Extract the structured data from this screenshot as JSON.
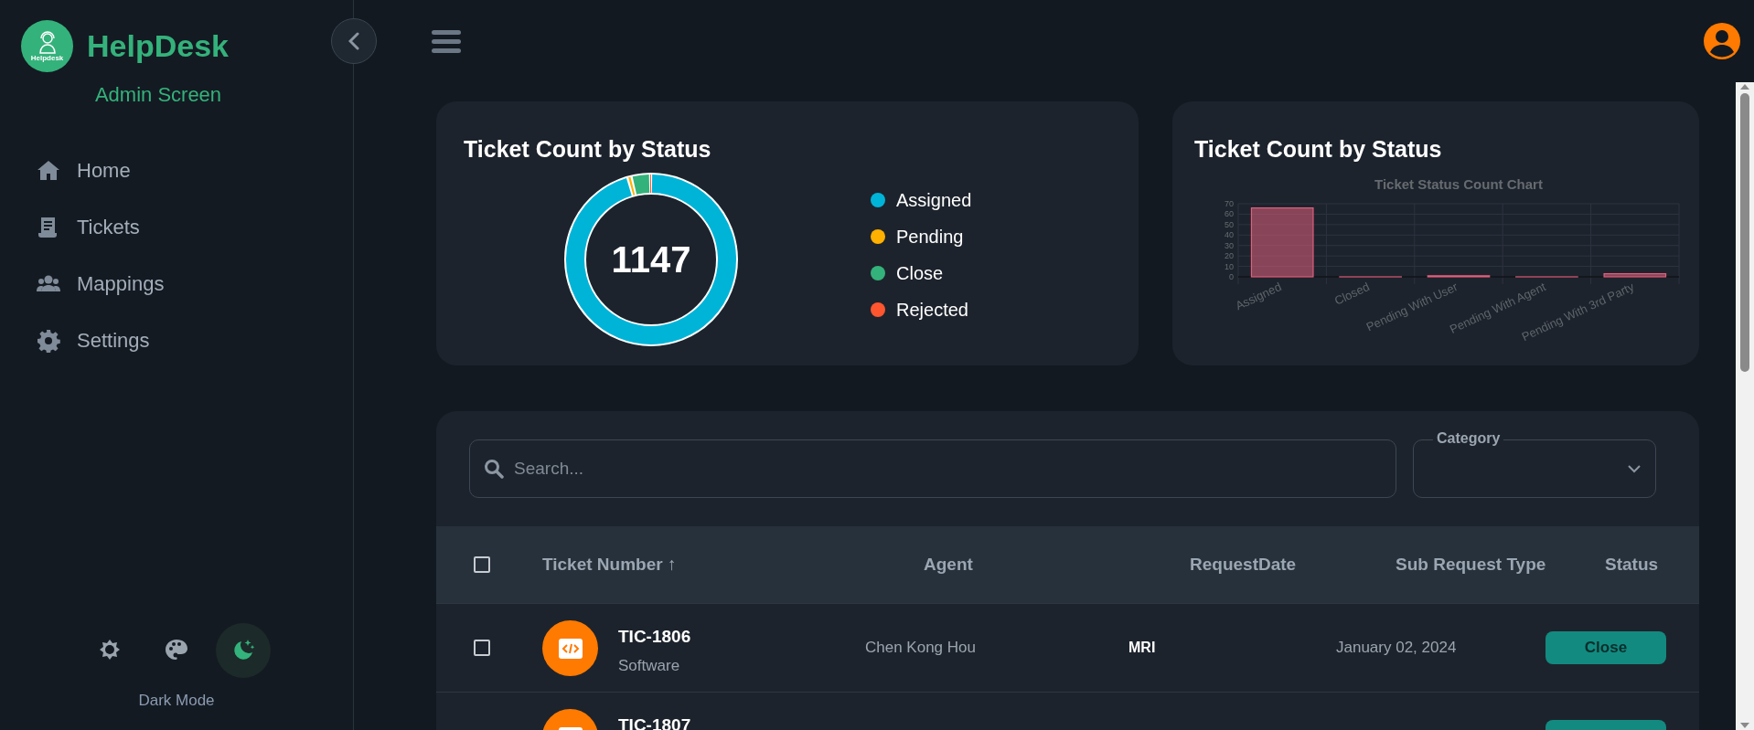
{
  "sidebar": {
    "logo_caption": "Helpdesk",
    "brand": "HelpDesk",
    "subtitle": "Admin Screen",
    "nav_items": [
      {
        "label": "Home"
      },
      {
        "label": "Tickets"
      },
      {
        "label": "Mappings"
      },
      {
        "label": "Settings"
      }
    ],
    "theme_options": [
      {
        "kind": "light",
        "selected": false
      },
      {
        "kind": "palette",
        "selected": false
      },
      {
        "kind": "dark",
        "selected": true
      }
    ],
    "theme_label": "Dark Mode"
  },
  "status_card": {
    "title": "Ticket Count by Status",
    "total": "1147",
    "legend": [
      {
        "label": "Assigned",
        "color": "#00b4d8"
      },
      {
        "label": "Pending",
        "color": "#ffb000"
      },
      {
        "label": "Close",
        "color": "#34b27b"
      },
      {
        "label": "Rejected",
        "color": "#ff5630"
      }
    ]
  },
  "chart_card": {
    "title": "Ticket Count by Status",
    "chart_data": {
      "type": "bar",
      "title": "Ticket Status Count Chart",
      "categories": [
        "Assigned",
        "Closed",
        "Pending With User",
        "Pending With Agent",
        "Pending With 3rd Party"
      ],
      "values": [
        66,
        0,
        1,
        0,
        3
      ],
      "grid": true,
      "ylim": [
        0,
        70
      ],
      "yticks": [
        0,
        10,
        20,
        30,
        40,
        50,
        60,
        70
      ]
    }
  },
  "table": {
    "search": {
      "placeholder": "Search..."
    },
    "category_label": "Category",
    "select_all_checked": false,
    "columns": [
      "Ticket Number ↑",
      "Agent",
      "RequestDate",
      "Sub Request Type",
      "Status"
    ],
    "rows": [
      {
        "checked": false,
        "ticket": "TIC-1806",
        "category": "Software",
        "agent": "Chen Kong Hou",
        "request_date": "MRI",
        "sub_request_type": "January 02, 2024",
        "status": "Close"
      },
      {
        "ticket": "TIC-1807"
      }
    ]
  }
}
